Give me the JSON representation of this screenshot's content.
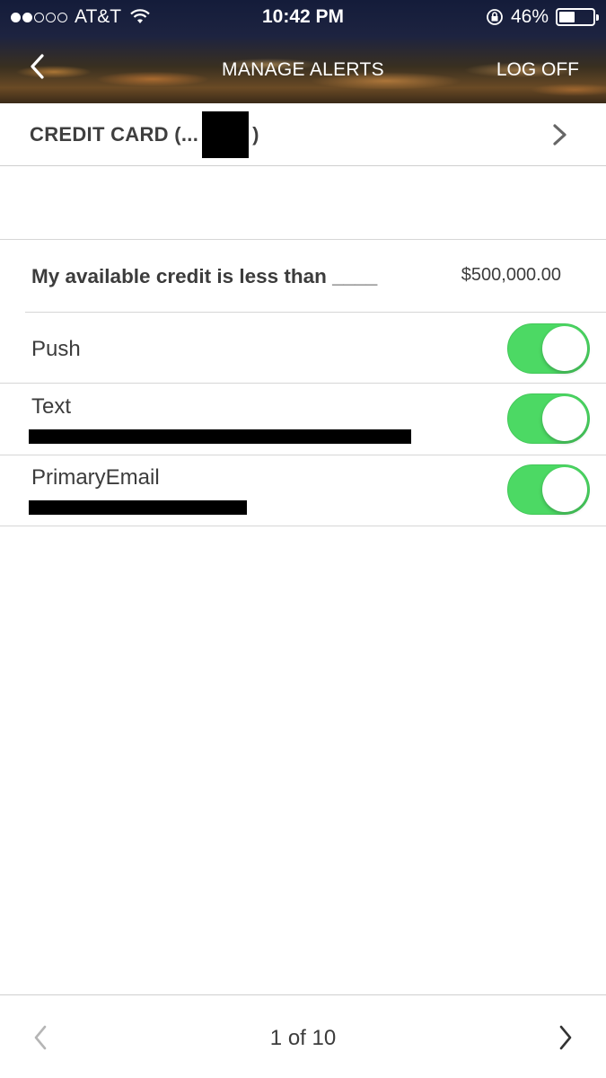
{
  "status_bar": {
    "signal_filled": 2,
    "signal_total": 5,
    "carrier": "AT&T",
    "time": "10:42 PM",
    "battery_percent": "46%",
    "battery_level": 0.46,
    "icons": [
      "wifi-icon",
      "orientation-lock-icon",
      "battery-icon"
    ]
  },
  "nav": {
    "back_icon": "chevron-left-icon",
    "title": "MANAGE ALERTS",
    "logoff_label": "LOG OFF"
  },
  "account": {
    "label_prefix": "CREDIT CARD (...",
    "label_suffix": ")",
    "chevron_icon": "chevron-right-icon"
  },
  "alert": {
    "text": "My available credit is less than ____",
    "amount": "$500,000.00"
  },
  "channels": [
    {
      "label": "Push",
      "enabled": true
    },
    {
      "label": "Text",
      "enabled": true
    },
    {
      "label": "PrimaryEmail",
      "enabled": true
    }
  ],
  "pager": {
    "text": "1 of 10",
    "prev_icon": "chevron-left-icon",
    "next_icon": "chevron-right-icon"
  },
  "colors": {
    "toggle_on": "#4cd964",
    "text": "#3c3c3c",
    "divider": "#d6d6d6"
  }
}
